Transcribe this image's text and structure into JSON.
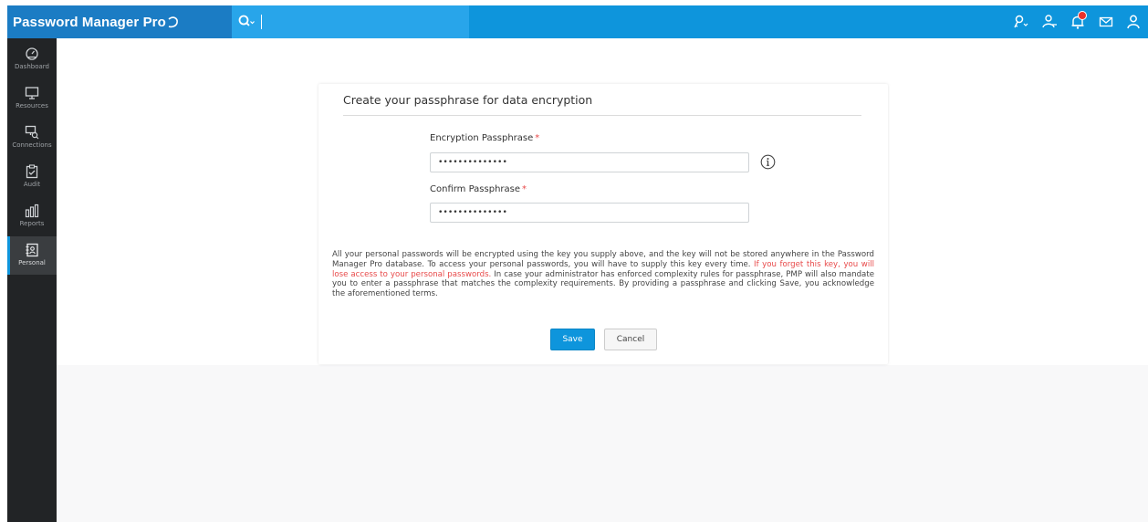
{
  "app": {
    "brand": "Password Manager Pro"
  },
  "header": {
    "search_placeholder": "",
    "icons": [
      "key-dropdown-icon",
      "user-add-icon",
      "notification-bell-icon",
      "mail-icon",
      "user-profile-icon"
    ],
    "notification_badge_color": "#e8312c"
  },
  "sidebar": {
    "items": [
      {
        "label": "Dashboard",
        "icon": "dashboard-icon"
      },
      {
        "label": "Resources",
        "icon": "monitor-icon"
      },
      {
        "label": "Connections",
        "icon": "connections-icon"
      },
      {
        "label": "Audit",
        "icon": "audit-clipboard-icon"
      },
      {
        "label": "Reports",
        "icon": "reports-chart-icon"
      },
      {
        "label": "Personal",
        "icon": "personal-contact-icon",
        "active": true
      }
    ]
  },
  "form": {
    "title": "Create your passphrase for data encryption",
    "encryption_label": "Encryption Passphrase",
    "encryption_value": "••••••••••••••",
    "confirm_label": "Confirm Passphrase",
    "confirm_value": "••••••••••••••",
    "required_marker": "*"
  },
  "notice": {
    "part1": "All your personal passwords will be encrypted using the key you supply above, and the key will not be stored anywhere in the Password Manager Pro database. To access your personal passwords, you will have to supply this key every time. ",
    "warning": "If you forget this key, you will lose access to your personal passwords.",
    "part2": " In case your administrator has enforced complexity rules for passphrase, PMP will also mandate you to enter a passphrase that matches the complexity requirements. By providing a passphrase and clicking Save, you acknowledge the aforementioned terms."
  },
  "actions": {
    "save": "Save",
    "cancel": "Cancel"
  },
  "colors": {
    "header": "#0e95dc",
    "brand_bg": "#1b7cc4",
    "sidebar": "#222426",
    "primary_button": "#0e95dc",
    "warning_text": "#e84a4a"
  }
}
